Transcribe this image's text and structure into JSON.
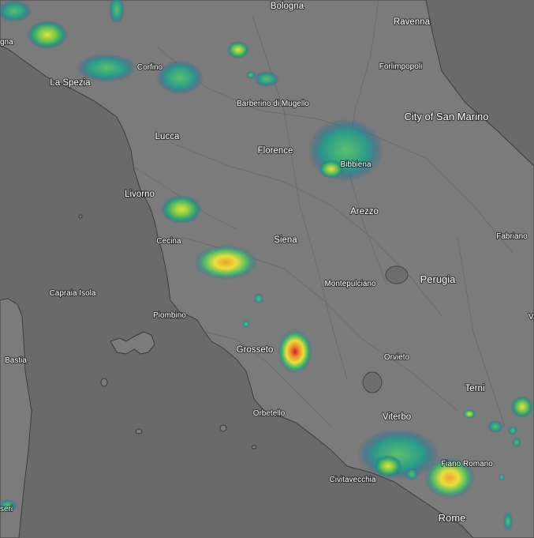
{
  "map": {
    "cities": [
      {
        "name": "Bologna",
        "size": "md"
      },
      {
        "name": "Ravenna",
        "size": "md"
      },
      {
        "name": "Forlimpopoli",
        "size": "sm"
      },
      {
        "name": "La Spezia",
        "size": "md"
      },
      {
        "name": "Corfino",
        "size": "sm"
      },
      {
        "name": "Barberino di Mugello",
        "size": "sm"
      },
      {
        "name": "City of San Marino",
        "size": "lg"
      },
      {
        "name": "Lucca",
        "size": "md"
      },
      {
        "name": "Florence",
        "size": "md"
      },
      {
        "name": "Bibbiena",
        "size": "sm"
      },
      {
        "name": "Livorno",
        "size": "md"
      },
      {
        "name": "Arezzo",
        "size": "md"
      },
      {
        "name": "Fabriano",
        "size": "sm"
      },
      {
        "name": "Cecina",
        "size": "sm"
      },
      {
        "name": "Siena",
        "size": "md"
      },
      {
        "name": "Perugia",
        "size": "lg"
      },
      {
        "name": "Montepulciano",
        "size": "sm"
      },
      {
        "name": "Capraia Isola",
        "size": "sm"
      },
      {
        "name": "Piombino",
        "size": "sm"
      },
      {
        "name": "Bastia",
        "size": "sm"
      },
      {
        "name": "Grosseto",
        "size": "md"
      },
      {
        "name": "Orvieto",
        "size": "sm"
      },
      {
        "name": "Terni",
        "size": "md"
      },
      {
        "name": "Orbetello",
        "size": "sm"
      },
      {
        "name": "Viterbo",
        "size": "md"
      },
      {
        "name": "Fiano Romano",
        "size": "sm"
      },
      {
        "name": "Civitavecchia",
        "size": "sm"
      },
      {
        "name": "Rome",
        "size": "lg"
      },
      {
        "name": "gna",
        "size": "sm"
      },
      {
        "name": "seri",
        "size": "sm"
      },
      {
        "name": "V",
        "size": "sm"
      }
    ],
    "colors": {
      "land": "#7b7b7b",
      "sea": "#6a6a6a",
      "border": "#3a3a3a",
      "road": "#8a8a8a",
      "radar_low": "#1e7fa0",
      "radar_mid": "#3fb56a",
      "radar_high": "#e8e03a",
      "radar_peak": "#c81e3c"
    }
  }
}
